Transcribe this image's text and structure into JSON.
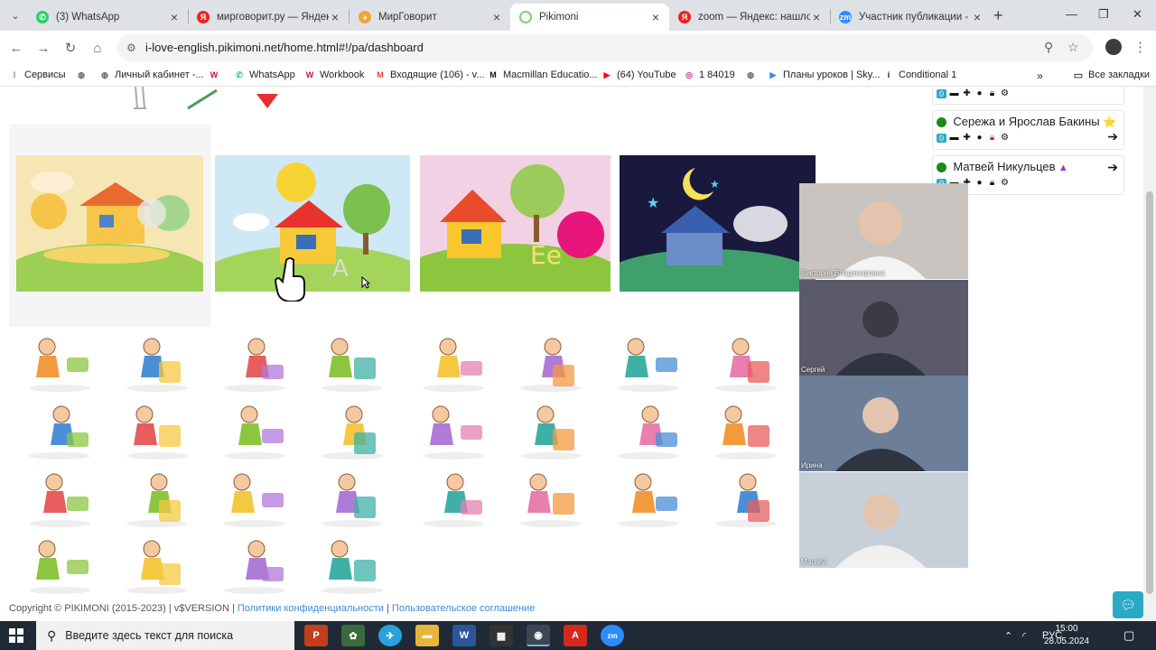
{
  "browser": {
    "tabs": [
      {
        "title": "(3) WhatsApp",
        "fav_color": "#25d366",
        "fav_glyph": "✆"
      },
      {
        "title": "мирговорит.ру — Яндекс",
        "fav_color": "#e22",
        "fav_glyph": "Я"
      },
      {
        "title": "МирГоворит",
        "fav_color": "#f2a33c",
        "fav_glyph": "◕"
      },
      {
        "title": "Pikimoni",
        "fav_color": "#ffffff",
        "fav_glyph": ""
      },
      {
        "title": "zoom — Яндекс: нашлось",
        "fav_color": "#e22",
        "fav_glyph": "Я"
      },
      {
        "title": "Участник публикации - Z",
        "fav_color": "#2d8cff",
        "fav_glyph": "zm"
      }
    ],
    "active_tab": 3,
    "url": "i-love-english.pikimoni.net/home.html#!/pa/dashboard",
    "bookmarks": [
      {
        "label": "Сервисы",
        "icon": "grid-icon",
        "color": "#5f6368"
      },
      {
        "label": "",
        "icon": "globe-icon",
        "color": "#5f6368"
      },
      {
        "label": "Личный кабинет -...",
        "icon": "globe-icon",
        "color": "#5f6368"
      },
      {
        "label": "",
        "icon": "workbook-icon",
        "color": "#c8102e"
      },
      {
        "label": "WhatsApp",
        "icon": "whatsapp-icon",
        "color": "#25d366"
      },
      {
        "label": "Workbook",
        "icon": "workbook-icon",
        "color": "#c8102e"
      },
      {
        "label": "Входящие (106) - v...",
        "icon": "gmail-icon",
        "color": "#ea4335"
      },
      {
        "label": "Macmillan Educatio...",
        "icon": "macmillan-icon",
        "color": "#111111"
      },
      {
        "label": "(64) YouTube",
        "icon": "youtube-icon",
        "color": "#ff0000"
      },
      {
        "label": "1 84019",
        "icon": "instagram-icon",
        "color": "#c13584"
      },
      {
        "label": "",
        "icon": "globe-icon",
        "color": "#5f6368"
      },
      {
        "label": "Планы уроков | Sky...",
        "icon": "skyeng-icon",
        "color": "#3b82f6"
      },
      {
        "label": "Conditional 1",
        "icon": "isl-icon",
        "color": "#111111"
      }
    ],
    "all_bookmarks_label": "Все закладки"
  },
  "users": [
    {
      "name": "Сережа и Ярослав Бакины",
      "badge": "⭐",
      "badge_color": "#f4c20d",
      "count": "0"
    },
    {
      "name": "Матвей Никульцев",
      "badge": "🔔",
      "badge_color": "#9b30d8",
      "count": "0"
    }
  ],
  "partial_user_count": "0",
  "zoom_participants": [
    {
      "name": "Виктория Владимировна",
      "bg": "#c9c4bf"
    },
    {
      "name": "Сергей",
      "bg": "#5b5a6a"
    },
    {
      "name": "Ирина",
      "bg": "#6d7f98"
    },
    {
      "name": "Матвей",
      "bg": "#c7d0d8"
    }
  ],
  "footer": {
    "copyright": "Copyright © PIKIMONI (2015-2023) | v$VERSION |",
    "privacy": "Политики конфиденциальности",
    "sep": "|",
    "agreement": "Пользовательское соглашение"
  },
  "taskbar": {
    "search_placeholder": "Введите здесь текст для поиска",
    "lang": "РУС",
    "time": "15:00",
    "date": "28.05.2024"
  }
}
